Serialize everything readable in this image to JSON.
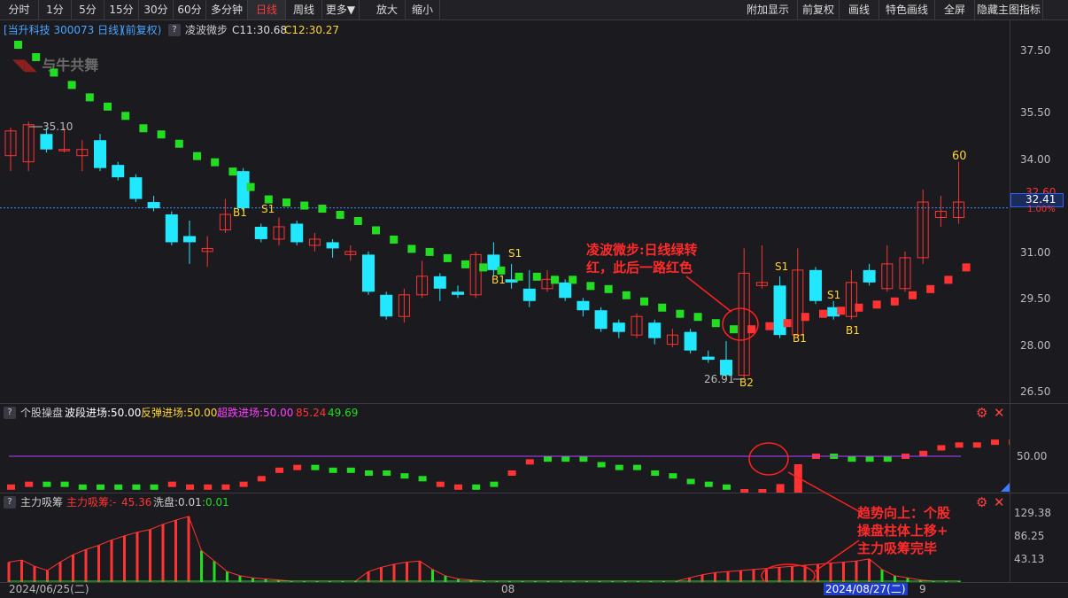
{
  "toolbar": {
    "left": [
      "分时",
      "1分",
      "5分",
      "15分",
      "30分",
      "60分",
      "多分钟",
      "日线",
      "周线",
      "更多▼",
      "放大",
      "缩小"
    ],
    "active": "日线",
    "right": [
      "附加显示",
      "前复权",
      "画线",
      "特色画线",
      "全屏",
      "隐藏主图指标"
    ]
  },
  "header": {
    "stock": "[当升科技 300073 日线]",
    "adjust": "(前复权)",
    "help": "?",
    "indicator": "凌波微步",
    "c1": "C11:30.68",
    "c2": "C12:30.27"
  },
  "watermark": "与牛共舞",
  "price_axis": {
    "ticks": [
      "37.50",
      "35.50",
      "34.00",
      "31.00",
      "29.50",
      "28.00",
      "26.50"
    ],
    "current_price": "32.41",
    "ghost_price": "32.60",
    "ghost_pct": "1.00%"
  },
  "marks": {
    "high_label": "35.10",
    "low_label": "26.91",
    "top_label": "60",
    "signals": [
      "B1",
      "S1",
      "S1",
      "B1",
      "S1",
      "B1",
      "S1",
      "B1",
      "B2"
    ]
  },
  "annotations": {
    "main": [
      "凌波微步:日线绿转",
      "红，此后一路红色"
    ],
    "bottom": [
      "趋势向上：个股",
      "操盘柱体上移+",
      "主力吸筹完毕"
    ]
  },
  "panel2": {
    "help": "?",
    "name": "个股操盘",
    "items": [
      "波段进场:50.00",
      "反弹进场:50.00",
      "超跌进场:50.00",
      "85.24",
      "49.69"
    ],
    "tick": "50.00"
  },
  "panel3": {
    "help": "?",
    "name": "主力吸筹",
    "items": [
      "主力吸筹:-",
      "45.36",
      "洗盘:0.01",
      ":0.01"
    ],
    "ticks": [
      "129.38",
      "86.25",
      "43.13"
    ]
  },
  "dates": [
    "2024/06/25(二)",
    "08",
    "2024/08/27(二)",
    "9"
  ],
  "colors": {
    "up": "#ff3333",
    "down": "#22e8ff",
    "green": "#22dd22",
    "gold": "#ffd530",
    "purple": "#b040ff",
    "gray": "#bbbbbb"
  },
  "icons": [
    "gear-icon",
    "close-icon",
    "triangle-icon"
  ],
  "chart_data": {
    "type": "candlestick",
    "ylim": [
      26.5,
      37.5
    ],
    "candles": [
      {
        "o": 34.1,
        "c": 34.9,
        "h": 35.0,
        "l": 33.6
      },
      {
        "o": 33.9,
        "c": 35.1,
        "h": 35.2,
        "l": 33.6
      },
      {
        "o": 34.8,
        "c": 34.3,
        "h": 35.0,
        "l": 34.2
      },
      {
        "o": 34.3,
        "c": 34.3,
        "h": 35.0,
        "l": 34.2
      },
      {
        "o": 34.1,
        "c": 34.3,
        "h": 34.6,
        "l": 33.6
      },
      {
        "o": 34.6,
        "c": 33.7,
        "h": 34.8,
        "l": 33.6
      },
      {
        "o": 33.8,
        "c": 33.4,
        "h": 33.9,
        "l": 33.3
      },
      {
        "o": 33.4,
        "c": 32.7,
        "h": 33.5,
        "l": 32.6
      },
      {
        "o": 32.6,
        "c": 32.4,
        "h": 32.8,
        "l": 32.3
      },
      {
        "o": 32.2,
        "c": 31.3,
        "h": 32.3,
        "l": 31.2
      },
      {
        "o": 31.5,
        "c": 31.3,
        "h": 32.0,
        "l": 30.6
      },
      {
        "o": 31.0,
        "c": 31.1,
        "h": 31.5,
        "l": 30.5
      },
      {
        "o": 31.7,
        "c": 32.2,
        "h": 32.7,
        "l": 31.6
      },
      {
        "o": 33.6,
        "c": 32.4,
        "h": 33.7,
        "l": 32.3
      },
      {
        "o": 31.8,
        "c": 31.4,
        "h": 31.9,
        "l": 31.3
      },
      {
        "o": 31.4,
        "c": 31.8,
        "h": 32.1,
        "l": 31.2
      },
      {
        "o": 31.9,
        "c": 31.3,
        "h": 32.0,
        "l": 31.2
      },
      {
        "o": 31.2,
        "c": 31.4,
        "h": 31.6,
        "l": 31.0
      },
      {
        "o": 31.3,
        "c": 31.1,
        "h": 31.4,
        "l": 30.8
      },
      {
        "o": 30.9,
        "c": 31.0,
        "h": 31.2,
        "l": 30.7
      },
      {
        "o": 30.9,
        "c": 29.7,
        "h": 31.0,
        "l": 29.6
      },
      {
        "o": 29.6,
        "c": 28.9,
        "h": 29.7,
        "l": 28.8
      },
      {
        "o": 28.9,
        "c": 29.6,
        "h": 29.8,
        "l": 28.7
      },
      {
        "o": 29.6,
        "c": 30.2,
        "h": 30.7,
        "l": 29.5
      },
      {
        "o": 30.2,
        "c": 29.8,
        "h": 30.3,
        "l": 29.4
      },
      {
        "o": 29.7,
        "c": 29.6,
        "h": 29.9,
        "l": 29.5
      },
      {
        "o": 29.6,
        "c": 30.9,
        "h": 31.0,
        "l": 29.5
      },
      {
        "o": 30.9,
        "c": 30.4,
        "h": 31.3,
        "l": 30.2
      },
      {
        "o": 30.1,
        "c": 30.0,
        "h": 30.6,
        "l": 29.8
      },
      {
        "o": 29.8,
        "c": 29.4,
        "h": 30.4,
        "l": 29.2
      },
      {
        "o": 29.8,
        "c": 30.1,
        "h": 30.4,
        "l": 29.7
      },
      {
        "o": 30.0,
        "c": 29.5,
        "h": 30.1,
        "l": 29.4
      },
      {
        "o": 29.4,
        "c": 29.1,
        "h": 29.5,
        "l": 28.9
      },
      {
        "o": 29.1,
        "c": 28.5,
        "h": 29.2,
        "l": 28.4
      },
      {
        "o": 28.7,
        "c": 28.4,
        "h": 28.8,
        "l": 28.2
      },
      {
        "o": 28.3,
        "c": 28.9,
        "h": 29.0,
        "l": 28.2
      },
      {
        "o": 28.7,
        "c": 28.2,
        "h": 28.8,
        "l": 28.0
      },
      {
        "o": 28.0,
        "c": 28.3,
        "h": 28.5,
        "l": 27.9
      },
      {
        "o": 28.4,
        "c": 27.8,
        "h": 28.5,
        "l": 27.7
      },
      {
        "o": 27.6,
        "c": 27.5,
        "h": 27.8,
        "l": 27.4
      },
      {
        "o": 27.5,
        "c": 27.0,
        "h": 28.1,
        "l": 26.9
      },
      {
        "o": 27.0,
        "c": 30.3,
        "h": 31.1,
        "l": 26.9
      },
      {
        "o": 29.9,
        "c": 30.0,
        "h": 31.2,
        "l": 29.8
      },
      {
        "o": 29.9,
        "c": 28.3,
        "h": 30.2,
        "l": 28.2
      },
      {
        "o": 28.3,
        "c": 30.4,
        "h": 31.1,
        "l": 28.2
      },
      {
        "o": 30.4,
        "c": 29.4,
        "h": 30.5,
        "l": 29.3
      },
      {
        "o": 29.2,
        "c": 28.9,
        "h": 29.4,
        "l": 28.8
      },
      {
        "o": 28.9,
        "c": 30.0,
        "h": 30.4,
        "l": 28.8
      },
      {
        "o": 30.4,
        "c": 30.0,
        "h": 30.6,
        "l": 29.9
      },
      {
        "o": 29.8,
        "c": 30.6,
        "h": 31.2,
        "l": 29.7
      },
      {
        "o": 29.8,
        "c": 30.8,
        "h": 31.0,
        "l": 29.7
      },
      {
        "o": 30.8,
        "c": 32.6,
        "h": 33.0,
        "l": 30.6
      },
      {
        "o": 32.1,
        "c": 32.3,
        "h": 32.8,
        "l": 31.8
      },
      {
        "o": 32.1,
        "c": 32.6,
        "h": 33.9,
        "l": 31.9
      }
    ],
    "ma_dots": [
      {
        "v": 37.7,
        "t": "g"
      },
      {
        "v": 37.3,
        "t": "g"
      },
      {
        "v": 36.8,
        "t": "g"
      },
      {
        "v": 36.4,
        "t": "g"
      },
      {
        "v": 36.0,
        "t": "g"
      },
      {
        "v": 35.7,
        "t": "g"
      },
      {
        "v": 35.4,
        "t": "g"
      },
      {
        "v": 35.0,
        "t": "g"
      },
      {
        "v": 34.8,
        "t": "g"
      },
      {
        "v": 34.5,
        "t": "g"
      },
      {
        "v": 34.1,
        "t": "g"
      },
      {
        "v": 33.9,
        "t": "g"
      },
      {
        "v": 33.6,
        "t": "g"
      },
      {
        "v": 33.1,
        "t": "g"
      },
      {
        "v": 32.7,
        "t": "g"
      },
      {
        "v": 32.6,
        "t": "g"
      },
      {
        "v": 32.5,
        "t": "g"
      },
      {
        "v": 32.4,
        "t": "g"
      },
      {
        "v": 32.2,
        "t": "g"
      },
      {
        "v": 32.0,
        "t": "g"
      },
      {
        "v": 31.7,
        "t": "g"
      },
      {
        "v": 31.4,
        "t": "g"
      },
      {
        "v": 31.1,
        "t": "g"
      },
      {
        "v": 31.0,
        "t": "g"
      },
      {
        "v": 30.8,
        "t": "g"
      },
      {
        "v": 30.6,
        "t": "g"
      },
      {
        "v": 30.5,
        "t": "g"
      },
      {
        "v": 30.4,
        "t": "g"
      },
      {
        "v": 30.2,
        "t": "g"
      },
      {
        "v": 30.2,
        "t": "g"
      },
      {
        "v": 30.1,
        "t": "g"
      },
      {
        "v": 30.1,
        "t": "g"
      },
      {
        "v": 29.9,
        "t": "g"
      },
      {
        "v": 29.8,
        "t": "g"
      },
      {
        "v": 29.6,
        "t": "g"
      },
      {
        "v": 29.4,
        "t": "g"
      },
      {
        "v": 29.2,
        "t": "g"
      },
      {
        "v": 29.0,
        "t": "g"
      },
      {
        "v": 28.9,
        "t": "g"
      },
      {
        "v": 28.7,
        "t": "g"
      },
      {
        "v": 28.5,
        "t": "g"
      },
      {
        "v": 28.5,
        "t": "r"
      },
      {
        "v": 28.6,
        "t": "r"
      },
      {
        "v": 28.7,
        "t": "r"
      },
      {
        "v": 28.9,
        "t": "r"
      },
      {
        "v": 29.0,
        "t": "r"
      },
      {
        "v": 29.1,
        "t": "r"
      },
      {
        "v": 29.2,
        "t": "r"
      },
      {
        "v": 29.3,
        "t": "r"
      },
      {
        "v": 29.4,
        "t": "r"
      },
      {
        "v": 29.6,
        "t": "r"
      },
      {
        "v": 29.8,
        "t": "r"
      },
      {
        "v": 30.1,
        "t": "r"
      },
      {
        "v": 30.5,
        "t": "r"
      }
    ],
    "op_panel": {
      "ylim": [
        40,
        70
      ],
      "bars": [
        41,
        42,
        42,
        42,
        41,
        41,
        41,
        41,
        41,
        42,
        41,
        41,
        41,
        42,
        44,
        47,
        48,
        48,
        47,
        47,
        46,
        46,
        45,
        44,
        42,
        41,
        41,
        42,
        46,
        50,
        51,
        51,
        51,
        49,
        48,
        48,
        46,
        45,
        43,
        42,
        41,
        41,
        41,
        43,
        50,
        52,
        52,
        51,
        51,
        51,
        52,
        53,
        55,
        56,
        56,
        57,
        57
      ],
      "colors": [
        "r",
        "r",
        "g",
        "g",
        "g",
        "g",
        "g",
        "g",
        "g",
        "r",
        "r",
        "r",
        "r",
        "r",
        "r",
        "r",
        "r",
        "g",
        "g",
        "g",
        "g",
        "g",
        "g",
        "g",
        "r",
        "r",
        "g",
        "g",
        "r",
        "r",
        "g",
        "g",
        "g",
        "g",
        "g",
        "g",
        "g",
        "g",
        "g",
        "g",
        "g",
        "r",
        "r",
        "r",
        "r",
        "r",
        "g",
        "g",
        "g",
        "g",
        "r",
        "r",
        "r",
        "r",
        "r",
        "r",
        "r"
      ],
      "line": 50
    },
    "flow_panel": {
      "ylim": [
        0,
        135
      ],
      "values": [
        38,
        42,
        30,
        22,
        38,
        52,
        62,
        70,
        80,
        88,
        95,
        100,
        110,
        118,
        125,
        60,
        40,
        20,
        12,
        8,
        6,
        4,
        2,
        2,
        2,
        2,
        2,
        2,
        20,
        28,
        34,
        38,
        40,
        24,
        12,
        6,
        4,
        2,
        2,
        2,
        2,
        2,
        2,
        2,
        2,
        2,
        2,
        2,
        2,
        2,
        2,
        2,
        2,
        8,
        14,
        18,
        20,
        22,
        24,
        26,
        28,
        30,
        32,
        34,
        36,
        38,
        40,
        44,
        24,
        12,
        8,
        4,
        2,
        2,
        2
      ],
      "colors": [
        "r",
        "r",
        "r",
        "r",
        "r",
        "r",
        "r",
        "r",
        "r",
        "r",
        "r",
        "r",
        "r",
        "r",
        "r",
        "g",
        "g",
        "g",
        "g",
        "g",
        "g",
        "g",
        "g",
        "g",
        "g",
        "g",
        "g",
        "g",
        "r",
        "r",
        "r",
        "r",
        "r",
        "g",
        "g",
        "g",
        "g",
        "g",
        "g",
        "g",
        "g",
        "g",
        "g",
        "g",
        "g",
        "g",
        "g",
        "g",
        "g",
        "g",
        "g",
        "g",
        "g",
        "r",
        "r",
        "r",
        "r",
        "r",
        "r",
        "r",
        "r",
        "r",
        "r",
        "r",
        "r",
        "r",
        "r",
        "r",
        "g",
        "g",
        "g",
        "g",
        "g",
        "g",
        "g"
      ]
    }
  }
}
